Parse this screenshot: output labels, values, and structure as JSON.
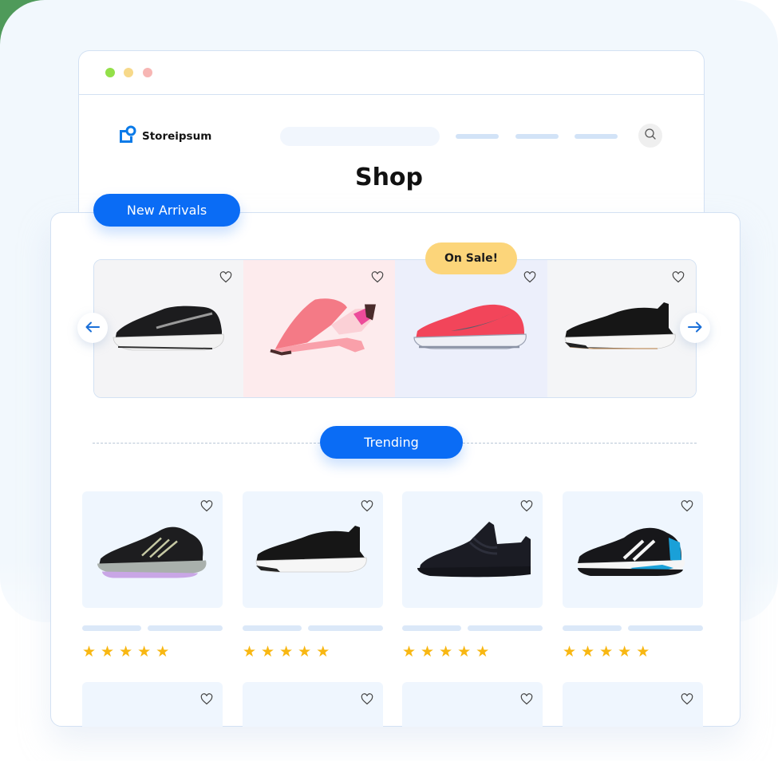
{
  "browser": {
    "window_dots": [
      "green",
      "yellow",
      "red"
    ],
    "colors": {
      "dot_green": "#93e049",
      "dot_yellow": "#f7d98a",
      "dot_red": "#f7b6b4"
    }
  },
  "header": {
    "logo_text": "Storeipsum",
    "logo_icon": "storeipsum-logo-icon",
    "search_icon": "search-icon",
    "nav_items_count": 3,
    "page_title": "Shop"
  },
  "new_arrivals": {
    "label": "New Arrivals",
    "badge": "On Sale!",
    "prev_icon": "arrow-left-icon",
    "next_icon": "arrow-right-icon",
    "slides": [
      {
        "name": "black-white-running-shoe",
        "bg": "#f4f4f6",
        "favorite": false
      },
      {
        "name": "pink-slip-on-shoe",
        "bg": "#fdebed",
        "favorite": false
      },
      {
        "name": "red-running-shoe",
        "bg": "#eceffb",
        "favorite": false,
        "on_sale": true
      },
      {
        "name": "black-knit-sneaker",
        "bg": "#f4f5f7",
        "favorite": false
      }
    ]
  },
  "trending": {
    "label": "Trending",
    "products": [
      {
        "name": "black-trail-shoe",
        "rating": 5,
        "favorite": false
      },
      {
        "name": "black-knit-sneaker",
        "rating": 5,
        "favorite": false
      },
      {
        "name": "black-laced-sneaker",
        "rating": 5,
        "favorite": false
      },
      {
        "name": "black-blue-court-shoe",
        "rating": 5,
        "favorite": false
      }
    ],
    "next_row_count": 4
  },
  "colors": {
    "accent": "#0a6cf5",
    "sale_badge": "#fcd57a",
    "star": "#f8b712",
    "border": "#d3e1f3",
    "placeholder": "#dbe8f8"
  }
}
